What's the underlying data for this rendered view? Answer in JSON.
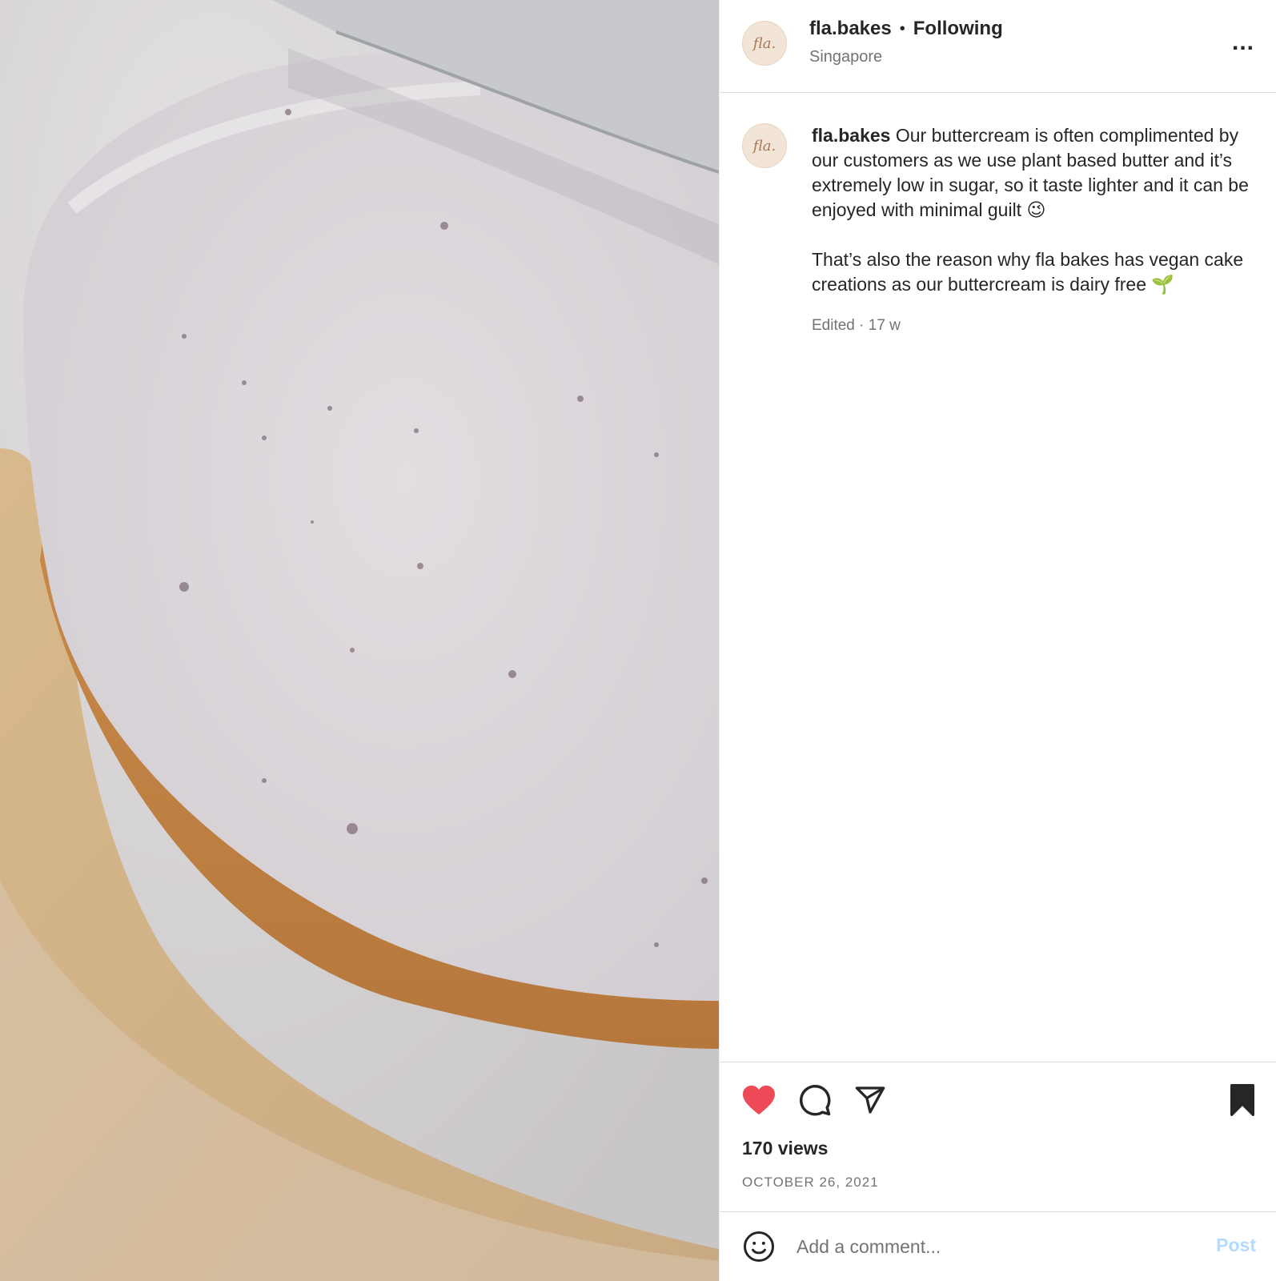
{
  "post": {
    "username": "fla.bakes",
    "separator": "•",
    "follow_status": "Following",
    "location": "Singapore",
    "avatar_text": "fla.",
    "more_label": "...",
    "more_icon": "more-horizontal-icon",
    "media_alt": "Cake with buttercream frosting being smoothed on a gold cake board"
  },
  "caption": {
    "username": "fla.bakes",
    "paragraph1": "Our buttercream is often complimented by our customers as we use plant based butter and it’s extremely low in sugar, so it taste lighter and it can be enjoyed with minimal guilt 😉",
    "paragraph2": "That’s also the reason why fla bakes has vegan cake creations as our buttercream is dairy free 🌱",
    "edited": "Edited · 17 w"
  },
  "actions": {
    "like_icon": "heart-filled-icon",
    "comment_icon": "comment-icon",
    "share_icon": "share-icon",
    "save_icon": "bookmark-filled-icon",
    "liked": true,
    "saved": true,
    "like_color": "#ed4956"
  },
  "stats": {
    "views": "170 views",
    "date": "OCTOBER 26, 2021"
  },
  "comment_box": {
    "emoji_icon": "emoji-icon",
    "placeholder": "Add a comment...",
    "post_label": "Post",
    "post_color": "#b3dbff"
  }
}
